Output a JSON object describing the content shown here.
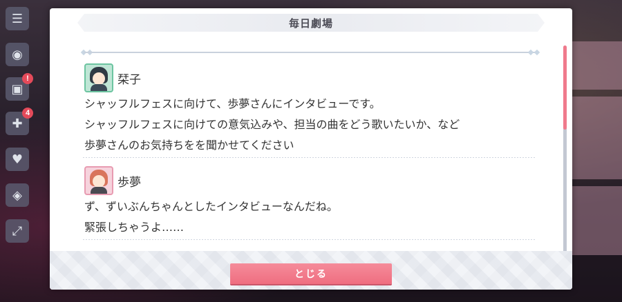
{
  "dialog": {
    "title": "毎日劇場",
    "close_label": "とじる"
  },
  "sidebar": {
    "badges": [
      "!",
      "4"
    ]
  },
  "entries": [
    {
      "speaker": "栞子",
      "avatar_color": "#6cc4a0",
      "lines": [
        "シャッフルフェスに向けて、歩夢さんにインタビューです。",
        "シャッフルフェスに向けての意気込みや、担当の曲をどう歌いたいか、など",
        "歩夢さんのお気持ちをを聞かせてください"
      ]
    },
    {
      "speaker": "歩夢",
      "avatar_color": "#e89bb1",
      "lines": [
        "ず、ずいぶんちゃんとしたインタビューなんだね。",
        "緊張しちゃうよ……"
      ]
    }
  ],
  "colors": {
    "accent": "#ef6e80",
    "scroll_thumb": "#f07a8c"
  },
  "scroll_position": 0.0
}
